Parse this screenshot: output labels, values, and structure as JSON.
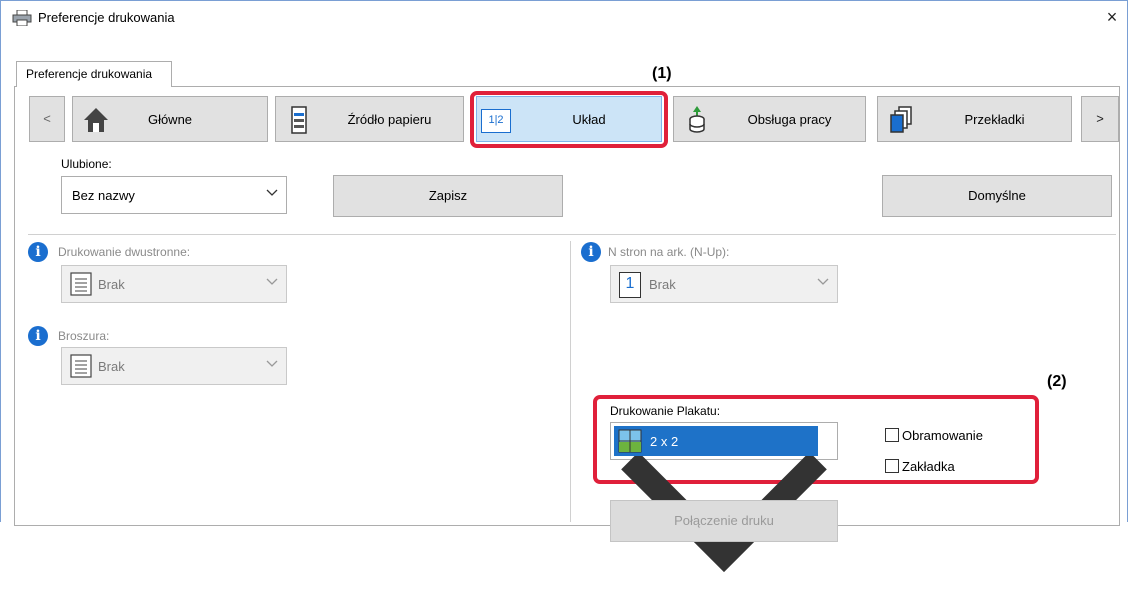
{
  "window": {
    "title": "Preferencje drukowania",
    "close": "×"
  },
  "tabs": [
    {
      "label": "Preferencje drukowania"
    }
  ],
  "nav": {
    "prev": "<",
    "next": ">",
    "items": [
      {
        "label": "Główne",
        "icon": "home-icon"
      },
      {
        "label": "Źródło papieru",
        "icon": "paper-tray-icon"
      },
      {
        "label": "Układ",
        "icon": "layout-icon",
        "icon_text": "1|2"
      },
      {
        "label": "Obsługa pracy",
        "icon": "job-handling-icon"
      },
      {
        "label": "Przekładki",
        "icon": "insert-pages-icon"
      }
    ]
  },
  "favorites": {
    "label": "Ulubione:",
    "value": "Bez nazwy",
    "save": "Zapisz",
    "defaults": "Domyślne"
  },
  "left": {
    "duplex": {
      "label": "Drukowanie dwustronne:",
      "value": "Brak"
    },
    "booklet": {
      "label": "Broszura:",
      "value": "Brak"
    }
  },
  "right": {
    "nup": {
      "label": "N stron na ark. (N-Up):",
      "value": "Brak",
      "icon_text": "1"
    },
    "poster": {
      "label": "Drukowanie Plakatu:",
      "value": "2 x 2"
    },
    "border_checkbox": {
      "label": "Obramowanie",
      "checked": false
    },
    "tab_checkbox": {
      "label": "Zakładka",
      "checked": false
    },
    "join_button": "Połączenie druku"
  },
  "callouts": {
    "one": "(1)",
    "two": "(2)"
  },
  "colors": {
    "highlight": "#e0203a",
    "selected_nav": "#cce4f7",
    "selected_item": "#1e72c8",
    "info": "#1a6ecf"
  }
}
